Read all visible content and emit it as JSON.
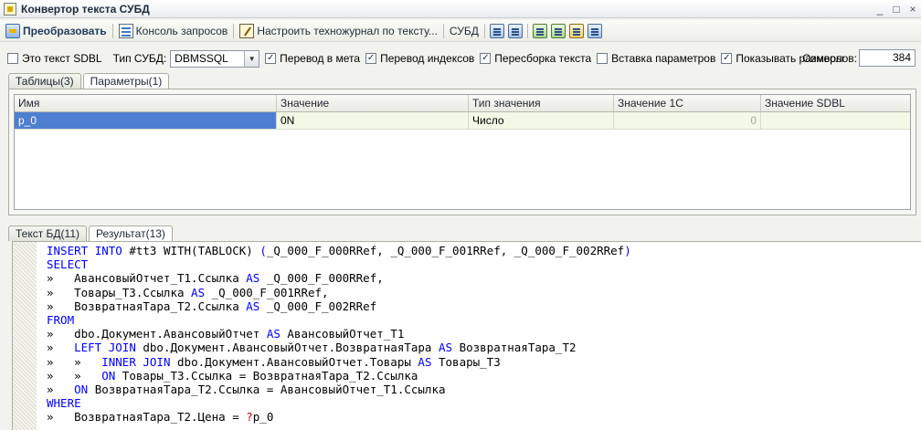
{
  "window": {
    "title": "Конвертор текста СУБД",
    "controls": {
      "minimize": "_",
      "maximize": "□",
      "close": "×"
    }
  },
  "toolbar": {
    "convert_label": "Преобразовать",
    "console_label": "Консоль запросов",
    "journal_label": "Настроить техножурнал по тексту...",
    "dbms_label": "СУБД",
    "icon_buttons": [
      "format-icon",
      "split-icon",
      "export-icon",
      "import-icon",
      "tree-icon",
      "window-icon"
    ]
  },
  "options": {
    "is_sdbl": {
      "label": "Это текст SDBL",
      "checked": false
    },
    "dbms_type_label": "Тип СУБД:",
    "dbms_type_value": "DBMSSQL",
    "translate_meta": {
      "label": "Перевод в мета",
      "checked": true
    },
    "translate_indexes": {
      "label": "Перевод индексов",
      "checked": true
    },
    "reassemble_text": {
      "label": "Пересборка текста",
      "checked": true
    },
    "insert_params": {
      "label": "Вставка параметров",
      "checked": false
    },
    "show_sizes": {
      "label": "Показывать размеры",
      "checked": true
    },
    "symbols_label": "Символов:",
    "symbols_value": "384"
  },
  "top_tabs": [
    {
      "label": "Таблицы(3)",
      "active": false
    },
    {
      "label": "Параметры(1)",
      "active": true
    }
  ],
  "params_grid": {
    "columns": [
      "Имя",
      "Значение",
      "Тип значения",
      "Значение 1С",
      "Значение SDBL"
    ],
    "rows": [
      {
        "name": "p_0",
        "value": "0N",
        "type": "Число",
        "value_1c": "0",
        "value_sdbl": ""
      }
    ]
  },
  "bottom_tabs": [
    {
      "label": "Текст БД(11)",
      "active": false
    },
    {
      "label": "Результат(13)",
      "active": true
    }
  ],
  "code_lines": [
    [
      [
        "kw",
        "INSERT "
      ],
      [
        "kw",
        "INTO "
      ],
      [
        "tx",
        "#tt3 WITH(TABLOCK) "
      ],
      [
        "kw",
        "("
      ],
      [
        "tx",
        "_Q_000_F_000RRef, _Q_000_F_001RRef, _Q_000_F_002RRef"
      ],
      [
        "kw",
        ")"
      ]
    ],
    [
      [
        "kw",
        "SELECT"
      ]
    ],
    [
      [
        "tx",
        "»   АвансовыйОтчет_Т1.Ссылка "
      ],
      [
        "kw",
        "AS "
      ],
      [
        "tx",
        "_Q_000_F_000RRef,"
      ]
    ],
    [
      [
        "tx",
        "»   Товары_Т3.Ссылка "
      ],
      [
        "kw",
        "AS "
      ],
      [
        "tx",
        "_Q_000_F_001RRef,"
      ]
    ],
    [
      [
        "tx",
        "»   ВозвратнаяТара_Т2.Ссылка "
      ],
      [
        "kw",
        "AS "
      ],
      [
        "tx",
        "_Q_000_F_002RRef"
      ]
    ],
    [
      [
        "kw",
        "FROM"
      ]
    ],
    [
      [
        "tx",
        "»   dbo.Документ.АвансовыйОтчет "
      ],
      [
        "kw",
        "AS "
      ],
      [
        "tx",
        "АвансовыйОтчет_Т1"
      ]
    ],
    [
      [
        "tx",
        "»   "
      ],
      [
        "kw",
        "LEFT JOIN "
      ],
      [
        "tx",
        "dbo.Документ.АвансовыйОтчет.ВозвратнаяТара "
      ],
      [
        "kw",
        "AS "
      ],
      [
        "tx",
        "ВозвратнаяТара_Т2"
      ]
    ],
    [
      [
        "tx",
        "»   »   "
      ],
      [
        "kw",
        "INNER JOIN "
      ],
      [
        "tx",
        "dbo.Документ.АвансовыйОтчет.Товары "
      ],
      [
        "kw",
        "AS "
      ],
      [
        "tx",
        "Товары_Т3"
      ]
    ],
    [
      [
        "tx",
        "»   »   "
      ],
      [
        "kw",
        "ON "
      ],
      [
        "tx",
        "Товары_Т3.Ссылка = ВозвратнаяТара_Т2.Ссылка"
      ]
    ],
    [
      [
        "tx",
        "»   "
      ],
      [
        "kw",
        "ON "
      ],
      [
        "tx",
        "ВозвратнаяТара_Т2.Ссылка = АвансовыйОтчет_Т1.Ссылка"
      ]
    ],
    [
      [
        "kw",
        "WHERE"
      ]
    ],
    [
      [
        "tx",
        "»   ВозвратнаяТара_Т2.Цена = "
      ],
      [
        "op",
        "?"
      ],
      [
        "tx",
        "p_0"
      ]
    ]
  ]
}
